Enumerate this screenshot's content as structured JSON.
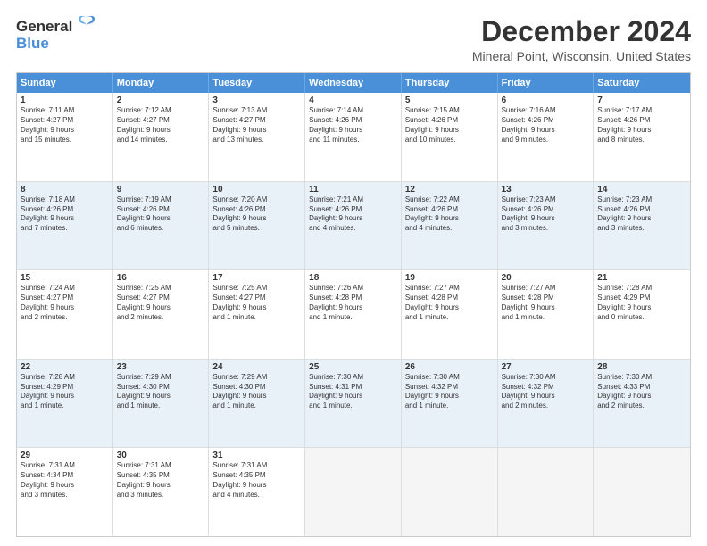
{
  "logo": {
    "line1": "General",
    "line2": "Blue"
  },
  "title": "December 2024",
  "subtitle": "Mineral Point, Wisconsin, United States",
  "header_days": [
    "Sunday",
    "Monday",
    "Tuesday",
    "Wednesday",
    "Thursday",
    "Friday",
    "Saturday"
  ],
  "rows": [
    {
      "shaded": false,
      "cells": [
        {
          "day": "1",
          "lines": [
            "Sunrise: 7:11 AM",
            "Sunset: 4:27 PM",
            "Daylight: 9 hours",
            "and 15 minutes."
          ]
        },
        {
          "day": "2",
          "lines": [
            "Sunrise: 7:12 AM",
            "Sunset: 4:27 PM",
            "Daylight: 9 hours",
            "and 14 minutes."
          ]
        },
        {
          "day": "3",
          "lines": [
            "Sunrise: 7:13 AM",
            "Sunset: 4:27 PM",
            "Daylight: 9 hours",
            "and 13 minutes."
          ]
        },
        {
          "day": "4",
          "lines": [
            "Sunrise: 7:14 AM",
            "Sunset: 4:26 PM",
            "Daylight: 9 hours",
            "and 11 minutes."
          ]
        },
        {
          "day": "5",
          "lines": [
            "Sunrise: 7:15 AM",
            "Sunset: 4:26 PM",
            "Daylight: 9 hours",
            "and 10 minutes."
          ]
        },
        {
          "day": "6",
          "lines": [
            "Sunrise: 7:16 AM",
            "Sunset: 4:26 PM",
            "Daylight: 9 hours",
            "and 9 minutes."
          ]
        },
        {
          "day": "7",
          "lines": [
            "Sunrise: 7:17 AM",
            "Sunset: 4:26 PM",
            "Daylight: 9 hours",
            "and 8 minutes."
          ]
        }
      ]
    },
    {
      "shaded": true,
      "cells": [
        {
          "day": "8",
          "lines": [
            "Sunrise: 7:18 AM",
            "Sunset: 4:26 PM",
            "Daylight: 9 hours",
            "and 7 minutes."
          ]
        },
        {
          "day": "9",
          "lines": [
            "Sunrise: 7:19 AM",
            "Sunset: 4:26 PM",
            "Daylight: 9 hours",
            "and 6 minutes."
          ]
        },
        {
          "day": "10",
          "lines": [
            "Sunrise: 7:20 AM",
            "Sunset: 4:26 PM",
            "Daylight: 9 hours",
            "and 5 minutes."
          ]
        },
        {
          "day": "11",
          "lines": [
            "Sunrise: 7:21 AM",
            "Sunset: 4:26 PM",
            "Daylight: 9 hours",
            "and 4 minutes."
          ]
        },
        {
          "day": "12",
          "lines": [
            "Sunrise: 7:22 AM",
            "Sunset: 4:26 PM",
            "Daylight: 9 hours",
            "and 4 minutes."
          ]
        },
        {
          "day": "13",
          "lines": [
            "Sunrise: 7:23 AM",
            "Sunset: 4:26 PM",
            "Daylight: 9 hours",
            "and 3 minutes."
          ]
        },
        {
          "day": "14",
          "lines": [
            "Sunrise: 7:23 AM",
            "Sunset: 4:26 PM",
            "Daylight: 9 hours",
            "and 3 minutes."
          ]
        }
      ]
    },
    {
      "shaded": false,
      "cells": [
        {
          "day": "15",
          "lines": [
            "Sunrise: 7:24 AM",
            "Sunset: 4:27 PM",
            "Daylight: 9 hours",
            "and 2 minutes."
          ]
        },
        {
          "day": "16",
          "lines": [
            "Sunrise: 7:25 AM",
            "Sunset: 4:27 PM",
            "Daylight: 9 hours",
            "and 2 minutes."
          ]
        },
        {
          "day": "17",
          "lines": [
            "Sunrise: 7:25 AM",
            "Sunset: 4:27 PM",
            "Daylight: 9 hours",
            "and 1 minute."
          ]
        },
        {
          "day": "18",
          "lines": [
            "Sunrise: 7:26 AM",
            "Sunset: 4:28 PM",
            "Daylight: 9 hours",
            "and 1 minute."
          ]
        },
        {
          "day": "19",
          "lines": [
            "Sunrise: 7:27 AM",
            "Sunset: 4:28 PM",
            "Daylight: 9 hours",
            "and 1 minute."
          ]
        },
        {
          "day": "20",
          "lines": [
            "Sunrise: 7:27 AM",
            "Sunset: 4:28 PM",
            "Daylight: 9 hours",
            "and 1 minute."
          ]
        },
        {
          "day": "21",
          "lines": [
            "Sunrise: 7:28 AM",
            "Sunset: 4:29 PM",
            "Daylight: 9 hours",
            "and 0 minutes."
          ]
        }
      ]
    },
    {
      "shaded": true,
      "cells": [
        {
          "day": "22",
          "lines": [
            "Sunrise: 7:28 AM",
            "Sunset: 4:29 PM",
            "Daylight: 9 hours",
            "and 1 minute."
          ]
        },
        {
          "day": "23",
          "lines": [
            "Sunrise: 7:29 AM",
            "Sunset: 4:30 PM",
            "Daylight: 9 hours",
            "and 1 minute."
          ]
        },
        {
          "day": "24",
          "lines": [
            "Sunrise: 7:29 AM",
            "Sunset: 4:30 PM",
            "Daylight: 9 hours",
            "and 1 minute."
          ]
        },
        {
          "day": "25",
          "lines": [
            "Sunrise: 7:30 AM",
            "Sunset: 4:31 PM",
            "Daylight: 9 hours",
            "and 1 minute."
          ]
        },
        {
          "day": "26",
          "lines": [
            "Sunrise: 7:30 AM",
            "Sunset: 4:32 PM",
            "Daylight: 9 hours",
            "and 1 minute."
          ]
        },
        {
          "day": "27",
          "lines": [
            "Sunrise: 7:30 AM",
            "Sunset: 4:32 PM",
            "Daylight: 9 hours",
            "and 2 minutes."
          ]
        },
        {
          "day": "28",
          "lines": [
            "Sunrise: 7:30 AM",
            "Sunset: 4:33 PM",
            "Daylight: 9 hours",
            "and 2 minutes."
          ]
        }
      ]
    },
    {
      "shaded": false,
      "cells": [
        {
          "day": "29",
          "lines": [
            "Sunrise: 7:31 AM",
            "Sunset: 4:34 PM",
            "Daylight: 9 hours",
            "and 3 minutes."
          ]
        },
        {
          "day": "30",
          "lines": [
            "Sunrise: 7:31 AM",
            "Sunset: 4:35 PM",
            "Daylight: 9 hours",
            "and 3 minutes."
          ]
        },
        {
          "day": "31",
          "lines": [
            "Sunrise: 7:31 AM",
            "Sunset: 4:35 PM",
            "Daylight: 9 hours",
            "and 4 minutes."
          ]
        },
        null,
        null,
        null,
        null
      ]
    }
  ]
}
